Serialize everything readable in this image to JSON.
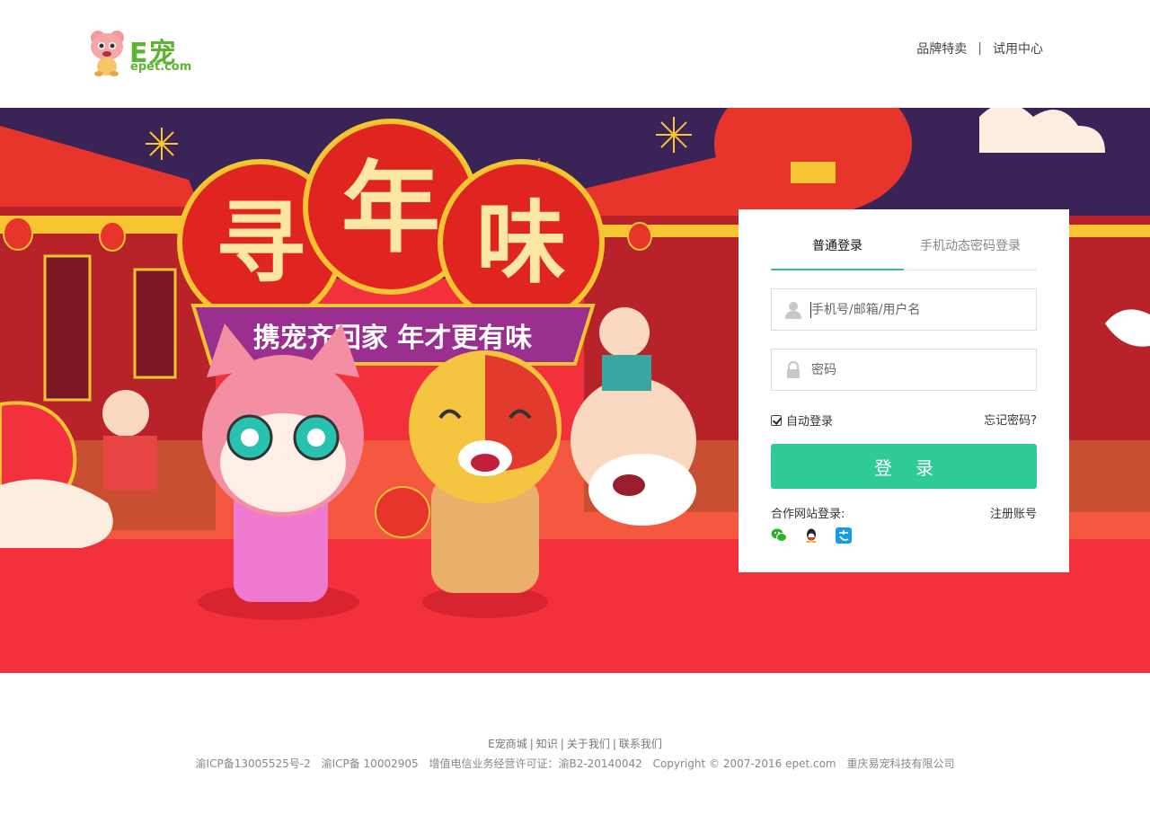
{
  "header": {
    "logo_text": "E宠",
    "logo_domain": "epet.com",
    "nav": [
      {
        "label": "品牌特卖"
      },
      {
        "label": "试用中心"
      }
    ],
    "nav_separator": "|"
  },
  "banner": {
    "title_chars": [
      "寻",
      "年",
      "味"
    ],
    "slogan": "携宠齐回家 年才更有味",
    "colors": {
      "background": "#f3313d",
      "gold": "#f7c531",
      "purple": "#9b2f8f",
      "night": "#3a2356"
    }
  },
  "login": {
    "tabs": [
      {
        "label": "普通登录",
        "active": true
      },
      {
        "label": "手机动态密码登录",
        "active": false
      }
    ],
    "username_placeholder": "手机号/邮箱/用户名",
    "password_placeholder": "密码",
    "remember_label": "自动登录",
    "remember_checked": true,
    "forgot_label": "忘记密码?",
    "submit_label": "登录",
    "partner_label": "合作网站登录:",
    "register_label": "注册账号",
    "social_icons": [
      "wechat-icon",
      "qq-icon",
      "alipay-icon"
    ],
    "accent_color": "#2fcb94"
  },
  "footer": {
    "links": [
      {
        "label": "E宠商城"
      },
      {
        "label": "知识"
      },
      {
        "label": "关于我们"
      },
      {
        "label": "联系我们"
      }
    ],
    "link_separator": "|",
    "copyright": [
      "渝ICP备13005525号-2",
      "渝ICP备 10002905",
      "增值电信业务经营许可证：渝B2-20140042",
      "Copyright © 2007-2016 epet.com",
      "重庆易宠科技有限公司"
    ]
  }
}
